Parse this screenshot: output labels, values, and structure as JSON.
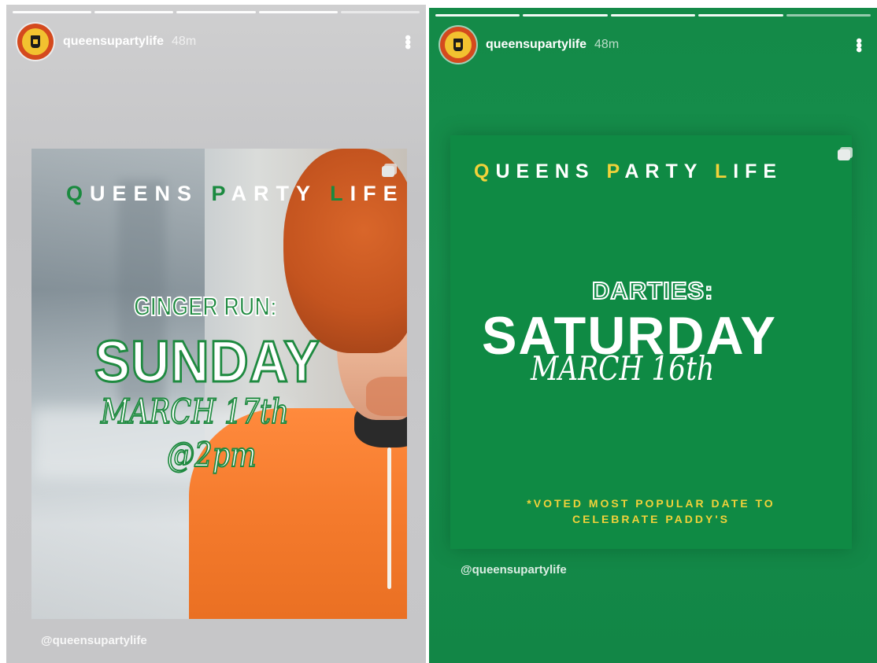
{
  "stories": [
    {
      "username": "queensupartylife",
      "time": "48m",
      "more_icon": "more-vertical-icon",
      "poster": {
        "brand": "QUEENS PARTY LIFE",
        "brand_accent_color": "#1a8a3f",
        "event": "GINGER RUN:",
        "day": "SUNDAY",
        "date": "MARCH 17th",
        "time": "@2pm"
      },
      "mention": "@queensupartylife"
    },
    {
      "username": "queensupartylife",
      "time": "48m",
      "more_icon": "more-vertical-icon",
      "poster": {
        "brand": "QUEENS PARTY LIFE",
        "brand_accent_color": "#f1d23a",
        "event": "DARTIES:",
        "day": "SATURDAY",
        "date": "MARCH 16th",
        "note_line1": "*VOTED MOST POPULAR DATE TO",
        "note_line2": "CELEBRATE PADDY'S"
      },
      "mention": "@queensupartylife"
    }
  ],
  "colors": {
    "story_green": "#148a48",
    "poster_green": "#0f8a44"
  }
}
